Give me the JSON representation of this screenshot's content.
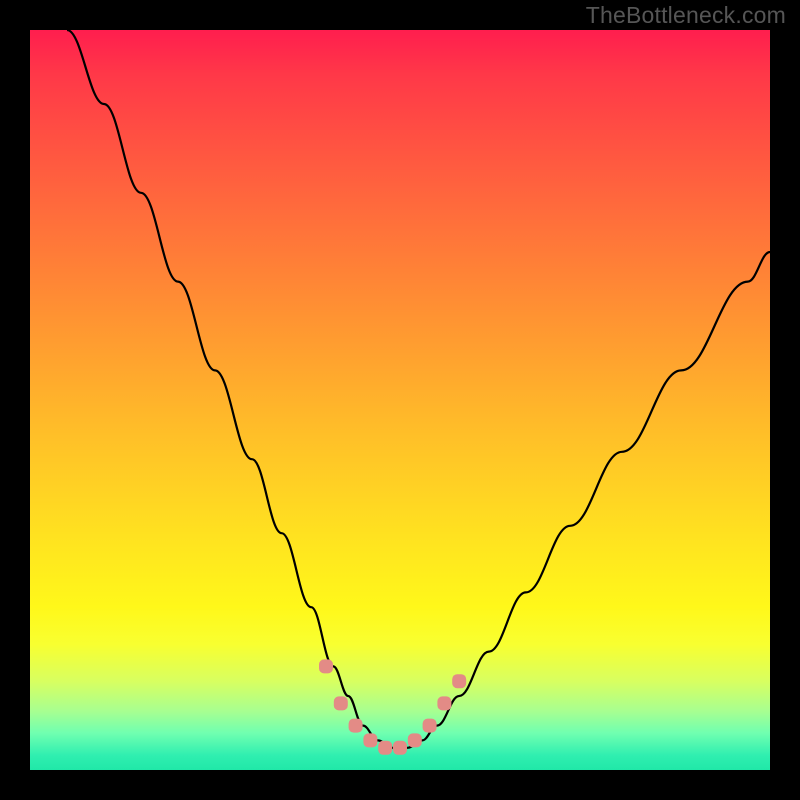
{
  "watermark": "TheBottleneck.com",
  "chart_data": {
    "type": "line",
    "title": "",
    "xlabel": "",
    "ylabel": "",
    "xlim": [
      0,
      100
    ],
    "ylim": [
      0,
      100
    ],
    "grid": false,
    "legend": false,
    "series": [
      {
        "name": "bottleneck-curve",
        "color": "#000000",
        "x": [
          5,
          10,
          15,
          20,
          25,
          30,
          34,
          38,
          41,
          43,
          45,
          47,
          49,
          51,
          53,
          55,
          58,
          62,
          67,
          73,
          80,
          88,
          97,
          100
        ],
        "values": [
          100,
          90,
          78,
          66,
          54,
          42,
          32,
          22,
          14,
          10,
          6,
          4,
          3,
          3,
          4,
          6,
          10,
          16,
          24,
          33,
          43,
          54,
          66,
          70
        ]
      }
    ],
    "markers": {
      "name": "bottleneck-region-markers",
      "color": "#e38b86",
      "points_x": [
        40,
        42,
        44,
        46,
        48,
        50,
        52,
        54,
        56,
        58
      ],
      "points_y": [
        14,
        9,
        6,
        4,
        3,
        3,
        4,
        6,
        9,
        12
      ]
    },
    "gradient_stops": [
      {
        "pos": 0.0,
        "color": "#ff1e4e"
      },
      {
        "pos": 0.18,
        "color": "#ff5a40"
      },
      {
        "pos": 0.42,
        "color": "#ff9c30"
      },
      {
        "pos": 0.68,
        "color": "#ffe120"
      },
      {
        "pos": 0.83,
        "color": "#f8ff30"
      },
      {
        "pos": 0.95,
        "color": "#70ffb0"
      },
      {
        "pos": 1.0,
        "color": "#20e8a8"
      }
    ]
  }
}
